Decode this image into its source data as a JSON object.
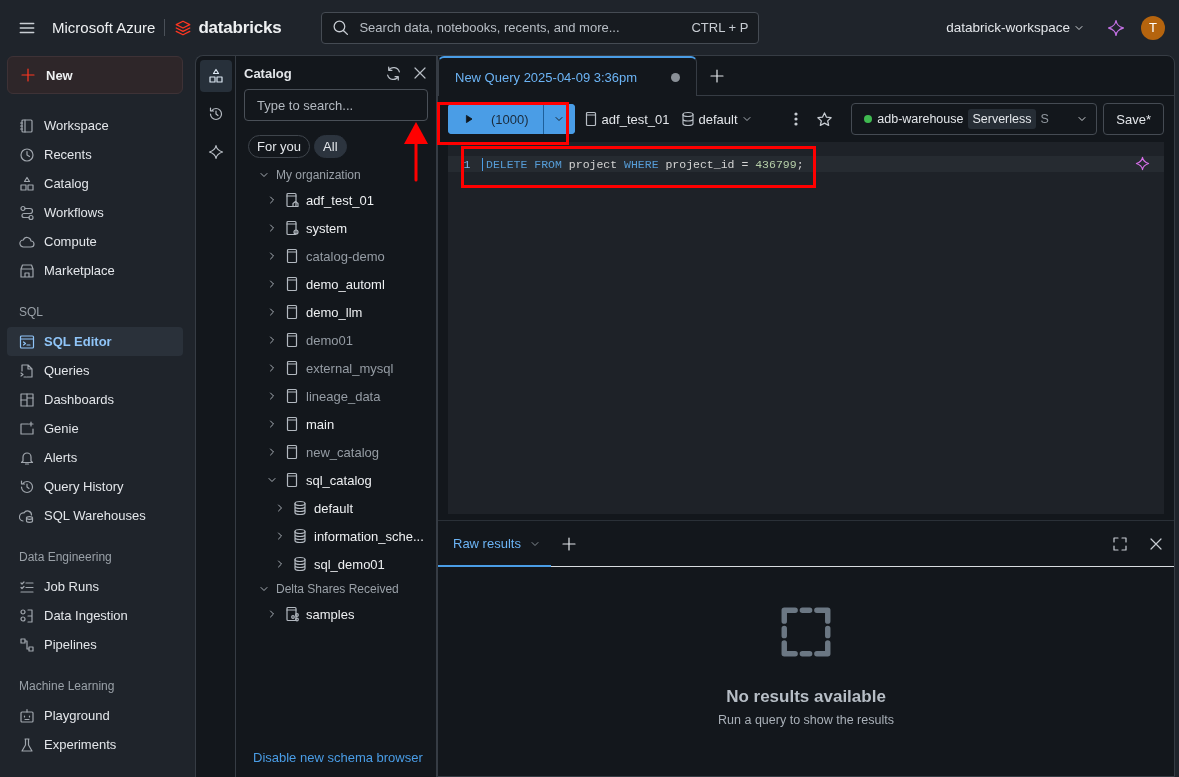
{
  "topbar": {
    "product": "Microsoft Azure",
    "logo_text": "databricks",
    "search": {
      "placeholder": "Search data, notebooks, recents, and more...",
      "shortcut": "CTRL + P"
    },
    "workspace": "databrick-workspace",
    "avatar": "T"
  },
  "sidebar": {
    "new_button": "New",
    "sections": [
      {
        "items": [
          {
            "label": "Workspace",
            "selected": false
          },
          {
            "label": "Recents",
            "selected": false
          },
          {
            "label": "Catalog",
            "selected": false
          },
          {
            "label": "Workflows",
            "selected": false
          },
          {
            "label": "Compute",
            "selected": false
          },
          {
            "label": "Marketplace",
            "selected": false
          }
        ]
      },
      {
        "header": "SQL",
        "items": [
          {
            "label": "SQL Editor",
            "selected": true
          },
          {
            "label": "Queries",
            "selected": false
          },
          {
            "label": "Dashboards",
            "selected": false
          },
          {
            "label": "Genie",
            "selected": false
          },
          {
            "label": "Alerts",
            "selected": false
          },
          {
            "label": "Query History",
            "selected": false
          },
          {
            "label": "SQL Warehouses",
            "selected": false
          }
        ]
      },
      {
        "header": "Data Engineering",
        "items": [
          {
            "label": "Job Runs",
            "selected": false
          },
          {
            "label": "Data Ingestion",
            "selected": false
          },
          {
            "label": "Pipelines",
            "selected": false
          }
        ]
      },
      {
        "header": "Machine Learning",
        "items": [
          {
            "label": "Playground",
            "selected": false
          },
          {
            "label": "Experiments",
            "selected": false
          }
        ]
      }
    ]
  },
  "catalog_panel": {
    "rail": [
      {
        "selected": true
      },
      {
        "selected": false
      },
      {
        "selected": false
      }
    ],
    "title": "Catalog",
    "search": {
      "placeholder": "Type to search...",
      "annotated": true
    },
    "filters": [
      {
        "label": "For you",
        "selected": false
      },
      {
        "label": "All",
        "selected": true
      }
    ],
    "tree": [
      {
        "kind": "group",
        "label": "My organization",
        "expanded": true,
        "children": [
          {
            "kind": "catalog-home",
            "label": "adf_test_01",
            "expanded": false,
            "dimmed": false
          },
          {
            "kind": "catalog-system",
            "label": "system",
            "expanded": false,
            "dimmed": false
          },
          {
            "kind": "catalog",
            "label": "catalog-demo",
            "expanded": false,
            "dimmed": true
          },
          {
            "kind": "catalog",
            "label": "demo_automl",
            "expanded": false,
            "dimmed": false
          },
          {
            "kind": "catalog",
            "label": "demo_llm",
            "expanded": false,
            "dimmed": false
          },
          {
            "kind": "catalog",
            "label": "demo01",
            "expanded": false,
            "dimmed": true
          },
          {
            "kind": "catalog",
            "label": "external_mysql",
            "expanded": false,
            "dimmed": true
          },
          {
            "kind": "catalog",
            "label": "lineage_data",
            "expanded": false,
            "dimmed": true
          },
          {
            "kind": "catalog",
            "label": "main",
            "expanded": false,
            "dimmed": false
          },
          {
            "kind": "catalog",
            "label": "new_catalog",
            "expanded": false,
            "dimmed": true
          },
          {
            "kind": "catalog",
            "label": "sql_catalog",
            "expanded": true,
            "dimmed": false,
            "children": [
              {
                "kind": "schema",
                "label": "default",
                "expanded": false,
                "dimmed": false
              },
              {
                "kind": "schema",
                "label": "information_sche...",
                "expanded": false,
                "dimmed": false
              },
              {
                "kind": "schema",
                "label": "sql_demo01",
                "expanded": false,
                "dimmed": false
              }
            ]
          }
        ]
      },
      {
        "kind": "group",
        "label": "Delta Shares Received",
        "expanded": true,
        "children": [
          {
            "kind": "share",
            "label": "samples",
            "expanded": false,
            "dimmed": false
          }
        ]
      }
    ],
    "footer_link": "Disable new schema browser"
  },
  "editor": {
    "tabs": [
      {
        "label": "New Query 2025-04-09 3:36pm",
        "selected": true,
        "unsaved": true
      }
    ],
    "toolbar": {
      "run_label": "(1000)",
      "run_annotated": true,
      "catalog": "adf_test_01",
      "schema": "default",
      "warehouse": {
        "name": "adb-warehouse",
        "badge": "Serverless",
        "size": "S",
        "running": true
      },
      "save": "Save*"
    },
    "code": {
      "annotated": true,
      "lines": [
        {
          "number": "1",
          "tokens": [
            {
              "text": "DELETE FROM",
              "kind": "keyword"
            },
            {
              "text": " project ",
              "kind": "plain"
            },
            {
              "text": "WHERE",
              "kind": "keyword"
            },
            {
              "text": " project_id ",
              "kind": "plain"
            },
            {
              "text": "= ",
              "kind": "operator"
            },
            {
              "text": "436799",
              "kind": "number"
            },
            {
              "text": ";",
              "kind": "plain"
            }
          ]
        }
      ]
    },
    "results": {
      "tabs": [
        {
          "label": "Raw results",
          "selected": true
        }
      ],
      "empty_title": "No results available",
      "empty_hint": "Run a query to show the results"
    }
  }
}
